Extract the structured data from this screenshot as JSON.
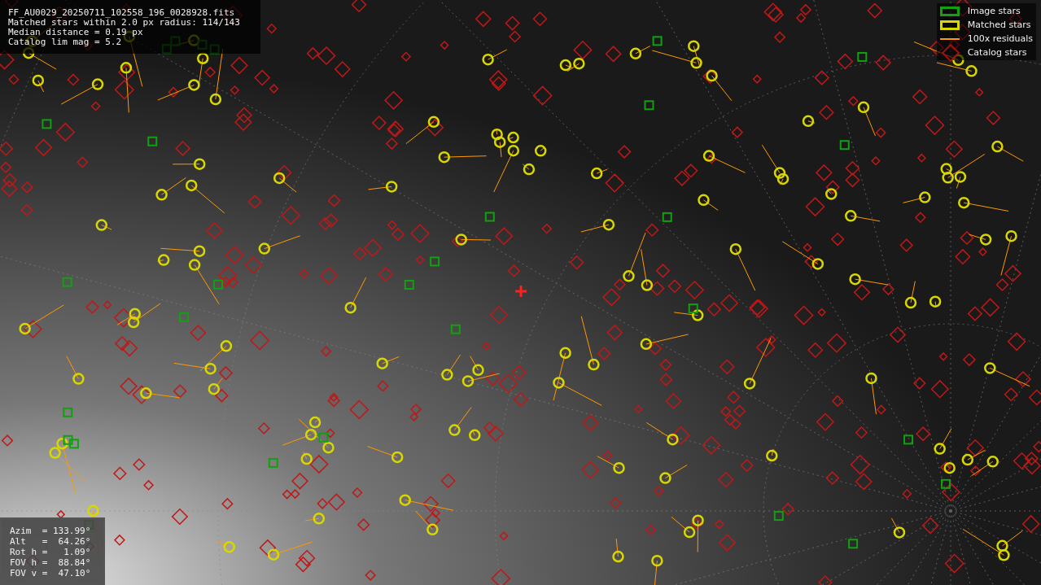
{
  "header": {
    "lines": [
      "FF_AU0029_20250711_102558_196_0028928.fits",
      "Matched stars within 2.0 px radius: 114/143",
      "Median distance = 0.19 px",
      "Catalog lim mag = 5.2"
    ]
  },
  "legend": [
    {
      "kind": "image",
      "label": "Image stars"
    },
    {
      "kind": "matched",
      "label": "Matched stars"
    },
    {
      "kind": "residual",
      "label": "100x residuals"
    },
    {
      "kind": "catalog",
      "label": "Catalog stars"
    }
  ],
  "pointing": {
    "lines": [
      "Azim  = 133.99°",
      "Alt   =  64.26°",
      "Rot h =   1.09°",
      "FOV h =  88.84°",
      "FOV v =  47.10°"
    ]
  }
}
